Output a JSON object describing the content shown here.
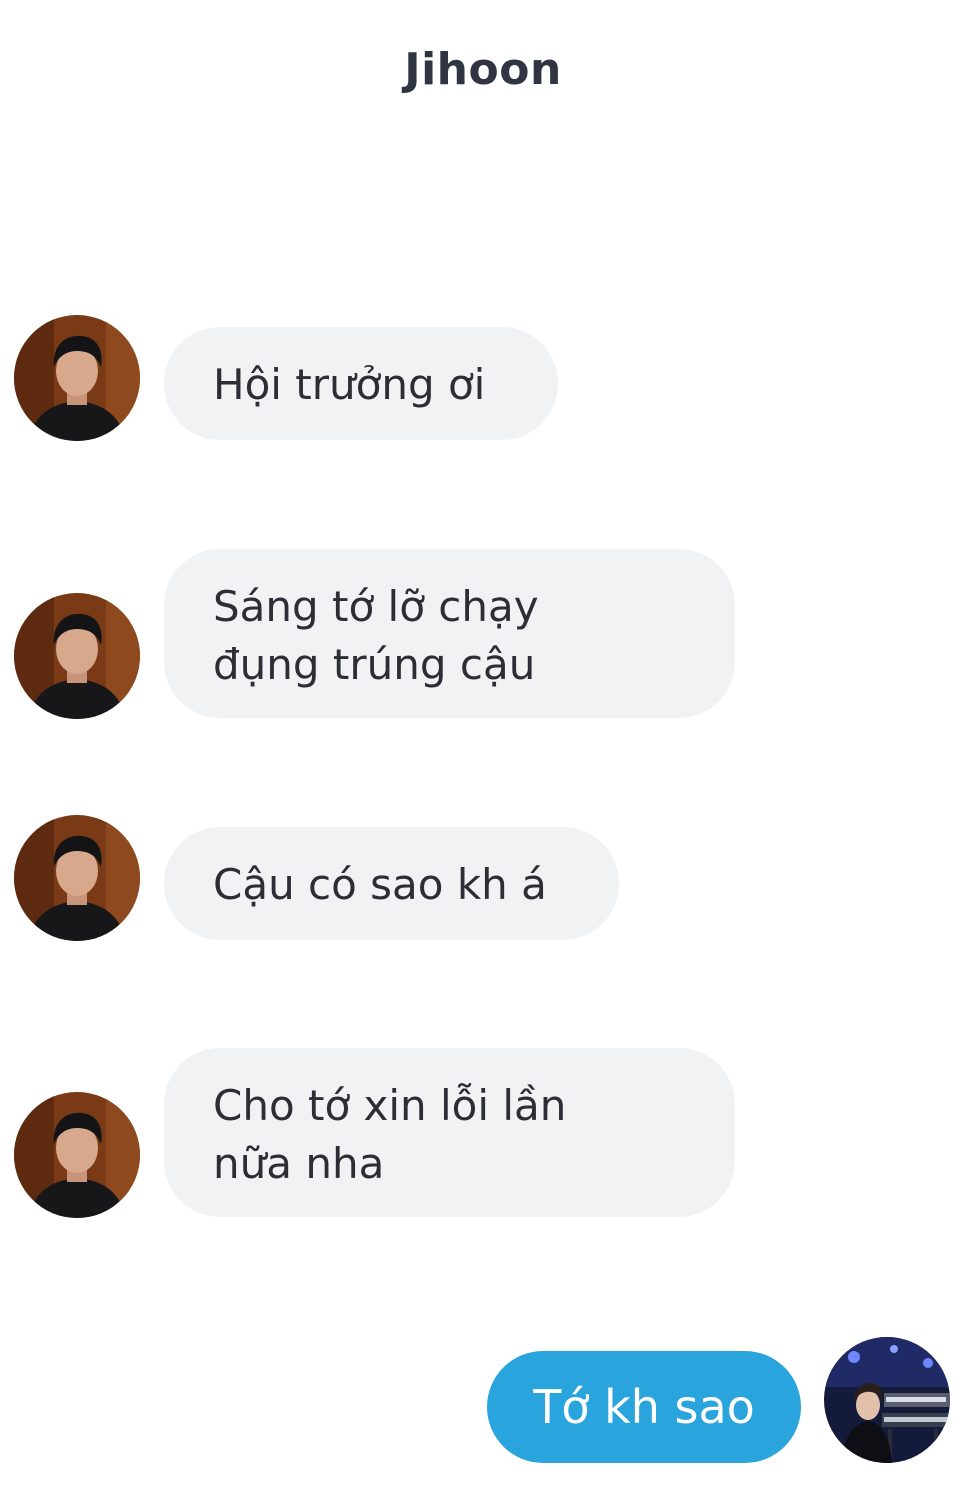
{
  "header": {
    "contact_name": "Jihoon"
  },
  "messages": [
    {
      "direction": "incoming",
      "text": "Hội trưởng ơi",
      "avatar_icon": "contact-avatar-icon"
    },
    {
      "direction": "incoming",
      "text": "Sáng tớ lỡ chạy\nđụng trúng cậu",
      "avatar_icon": "contact-avatar-icon"
    },
    {
      "direction": "incoming",
      "text": "Cậu có sao kh á",
      "avatar_icon": "contact-avatar-icon"
    },
    {
      "direction": "incoming",
      "text": "Cho tớ xin lỗi lần\nnữa nha",
      "avatar_icon": "contact-avatar-icon"
    },
    {
      "direction": "outgoing",
      "text": "Tớ kh sao",
      "avatar_icon": "user-avatar-icon"
    }
  ],
  "colors": {
    "incoming_bubble": "#f1f2f4",
    "outgoing_bubble": "#29a4dc",
    "title_text": "#2f3542"
  }
}
